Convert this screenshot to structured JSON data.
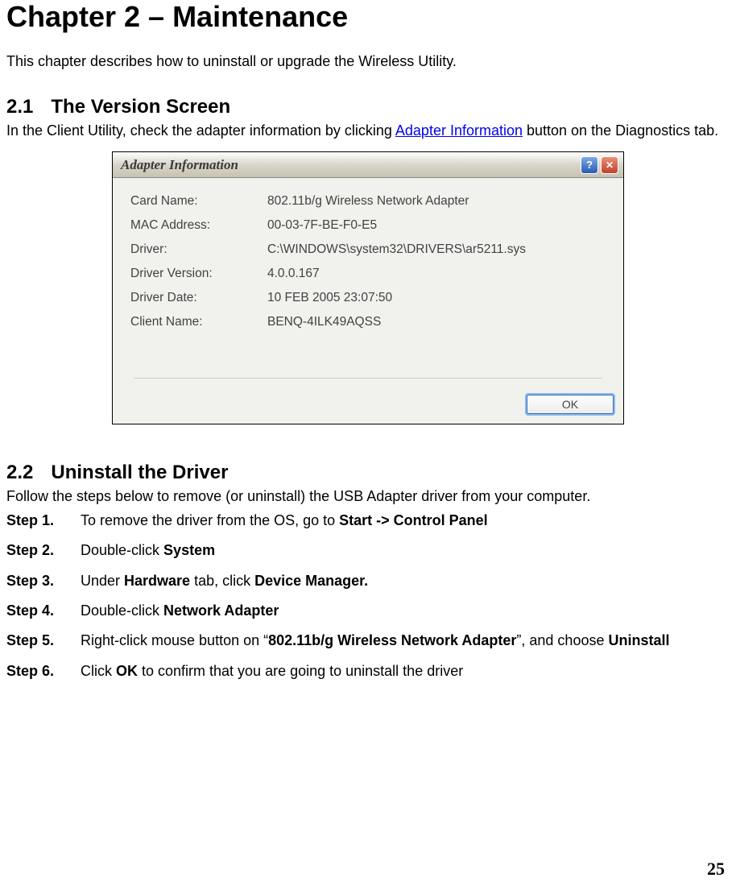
{
  "chapter": {
    "title": "Chapter 2 – Maintenance",
    "intro": "This chapter describes how to uninstall or upgrade the Wireless Utility."
  },
  "section1": {
    "num": "2.1",
    "title": "The Version Screen",
    "body_pre": "In the Client Utility, check the adapter information by clicking ",
    "link": "Adapter Information",
    "body_post": " button on the Diagnostics tab."
  },
  "dialog": {
    "title": "Adapter Information",
    "help": "?",
    "rows": {
      "card_name_label": "Card Name:",
      "card_name_value_a": "802.11b",
      "card_name_value_b": "/g Wireless Network Adapter",
      "mac_label": "MAC Address:",
      "mac_value": "00-03-7F-BE-F0-E5",
      "driver_label": "Driver:",
      "driver_value": "C:\\WINDOWS\\system32\\DRIVERS\\ar5211.sys",
      "driver_ver_label": "Driver Version:",
      "driver_ver_value": "4.0.0.167",
      "driver_date_label": "Driver Date:",
      "driver_date_value": "10 FEB 2005 23:07:50",
      "client_label": "Client Name:",
      "client_value": "BENQ-4ILK49AQSS"
    },
    "ok": "OK"
  },
  "section2": {
    "num": "2.2",
    "title": "Uninstall the Driver",
    "intro": "Follow the steps below to remove (or uninstall) the USB Adapter driver from your computer.",
    "steps": {
      "s1_label": "Step 1.",
      "s1_a": "To remove the driver from the OS, go to ",
      "s1_b": "Start -> Control Panel",
      "s2_label": "Step 2.",
      "s2_a": "Double-click ",
      "s2_b": "System",
      "s3_label": "Step 3.",
      "s3_a": "Under ",
      "s3_b": "Hardware",
      "s3_c": " tab, click ",
      "s3_d": "Device Manager.",
      "s4_label": "Step 4.",
      "s4_a": "Double-click ",
      "s4_b": "Network Adapter",
      "s5_label": "Step 5.",
      "s5_a": "Right-click mouse button on “",
      "s5_b": "802.11b/g Wireless Network Adapter",
      "s5_c": "”, and choose ",
      "s5_d": "Uninstall",
      "s6_label": "Step 6.",
      "s6_a": "Click ",
      "s6_b": "OK",
      "s6_c": " to confirm that you are going to uninstall the driver"
    }
  },
  "page_number": "25"
}
